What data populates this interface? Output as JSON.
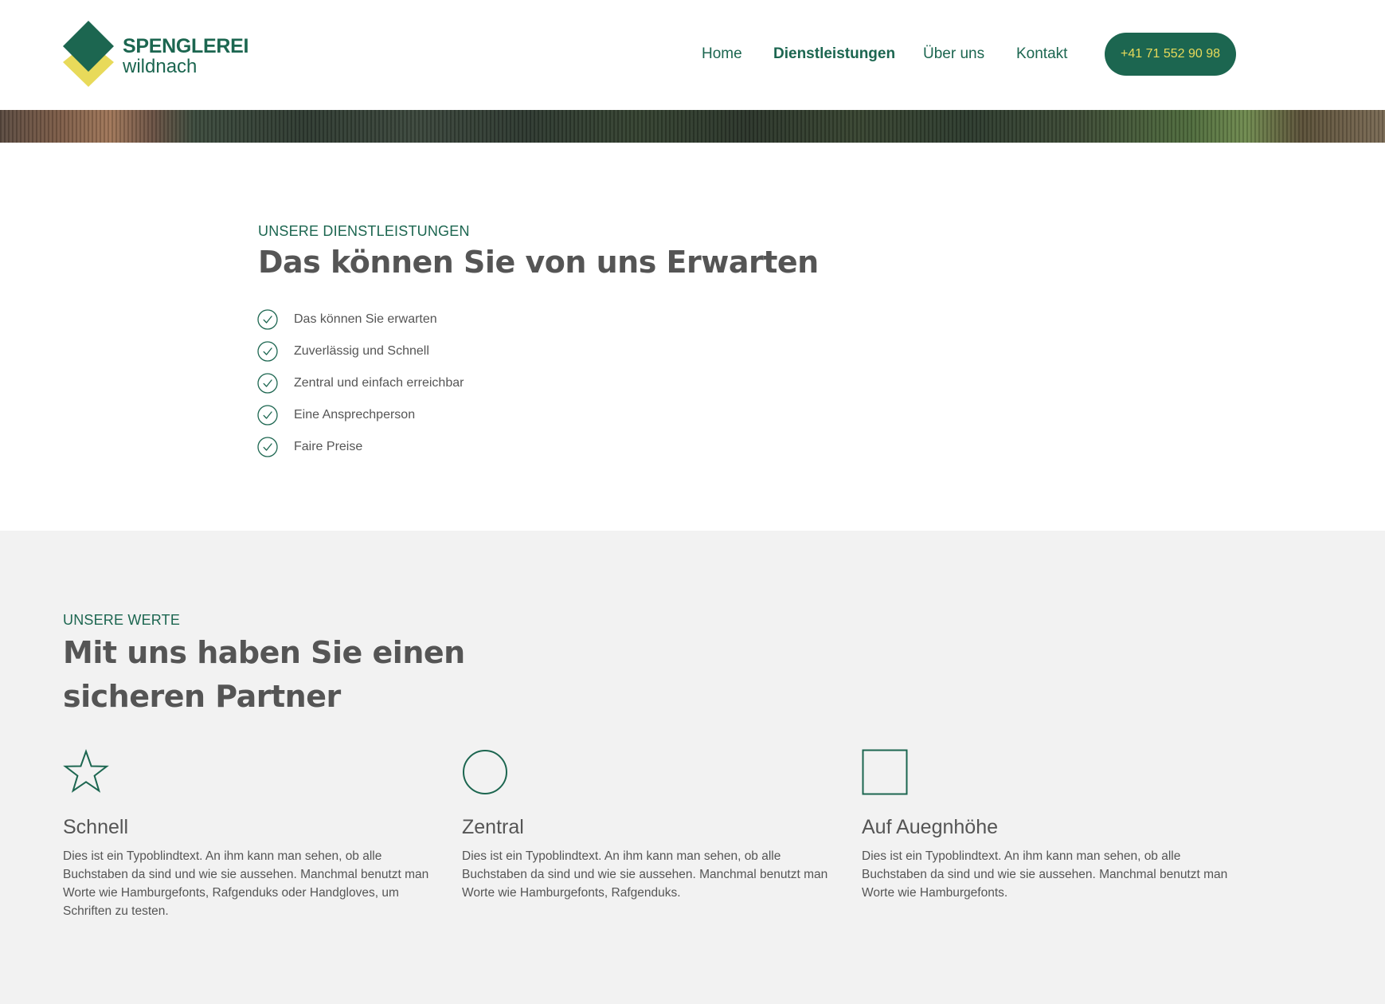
{
  "colors": {
    "brand_green": "#1c6650",
    "brand_yellow": "#e8da5a",
    "text_gray": "#555555",
    "section_gray": "#f2f2f2"
  },
  "header": {
    "logo": {
      "icon": "diamond-logo-icon",
      "name_line1": "SPENGLEREI",
      "name_line2": "wildnach"
    },
    "nav": {
      "items": [
        {
          "label": "Home",
          "active": false
        },
        {
          "label": "Dienstleistungen",
          "active": true
        },
        {
          "label": "Über uns",
          "active": false
        },
        {
          "label": "Kontakt",
          "active": false
        }
      ]
    },
    "cta": {
      "label": "+41 71 552 90 98"
    }
  },
  "services": {
    "eyebrow": "UNSERE DIENSTLEISTUNGEN",
    "title": "Das können Sie von uns Erwarten",
    "items": [
      {
        "icon": "check-circle-icon",
        "label": "Das können Sie erwarten"
      },
      {
        "icon": "check-circle-icon",
        "label": "Zuverlässig und Schnell"
      },
      {
        "icon": "check-circle-icon",
        "label": "Zentral und einfach erreichbar"
      },
      {
        "icon": "check-circle-icon",
        "label": "Eine Ansprechperson"
      },
      {
        "icon": "check-circle-icon",
        "label": "Faire Preise"
      }
    ]
  },
  "values": {
    "eyebrow": "UNSERE WERTE",
    "title": "Mit uns haben Sie einen sicheren Partner",
    "cards": [
      {
        "icon": "star-icon",
        "title": "Schnell",
        "text": "Dies ist ein Typoblindtext. An ihm kann man sehen, ob alle Buchstaben da sind und wie sie aussehen. Manchmal benutzt man Worte wie Hamburgefonts, Rafgenduks oder Handgloves, um Schriften zu testen."
      },
      {
        "icon": "circle-icon",
        "title": "Zentral",
        "text": "Dies ist ein Typoblindtext. An ihm kann man sehen, ob alle Buchstaben da sind und wie sie aussehen. Manchmal benutzt man Worte wie Hamburgefonts, Rafgenduks."
      },
      {
        "icon": "square-icon",
        "title": "Auf Auegnhöhe",
        "text": "Dies ist ein Typoblindtext. An ihm kann man sehen, ob alle Buchstaben da sind und wie sie aussehen. Manchmal benutzt man Worte wie Hamburgefonts."
      }
    ]
  }
}
